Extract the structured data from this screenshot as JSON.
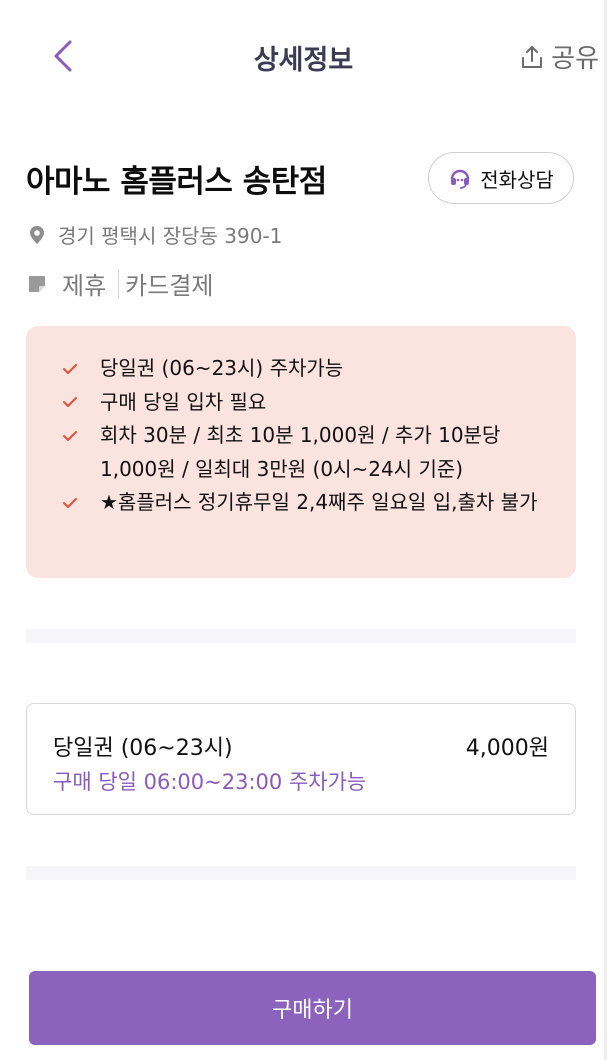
{
  "header": {
    "title": "상세정보",
    "share_label": "공유",
    "back_icon": "chevron-left-icon",
    "share_icon": "share-icon",
    "accent": "#8a5bbf"
  },
  "store": {
    "name": "아마노 홈플러스 송탄점",
    "call_label": "전화상담",
    "address": "경기 평택시 장당동 390-1",
    "tags": [
      "제휴",
      "카드결제"
    ]
  },
  "notice": {
    "background": "#fbe3e0",
    "check_color": "#e0503c",
    "items": [
      "당일권 (06~23시) 주차가능",
      "구매 당일 입차 필요",
      "회차 30분 / 최초 10분 1,000원 / 추가 10분당 1,000원 / 일최대 3만원 (0시~24시 기준)",
      "★홈플러스 정기휴무일 2,4째주 일요일 입,출차 불가"
    ]
  },
  "ticket": {
    "name": "당일권 (06~23시)",
    "price": "4,000원",
    "description": "구매 당일 06:00~23:00 주차가능"
  },
  "footer": {
    "buy_label": "구매하기",
    "button_color": "#8b63bd"
  }
}
